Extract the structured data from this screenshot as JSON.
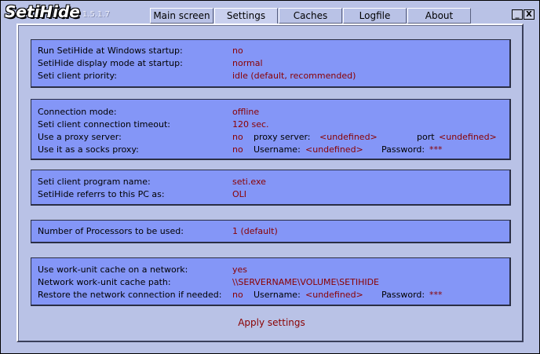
{
  "app": {
    "logo": "SetiHide",
    "version": "1.5.1.7"
  },
  "tabs": [
    "Main screen",
    "Settings",
    "Caches",
    "Logfile",
    "About"
  ],
  "window_buttons": {
    "minimize": "_",
    "close": "X"
  },
  "startup": {
    "run_at_startup_label": "Run SetiHide at Windows startup:",
    "run_at_startup_value": "no",
    "display_mode_label": "SetiHide display mode at startup:",
    "display_mode_value": "normal",
    "priority_label": "Seti client priority:",
    "priority_value": "idle (default, recommended)"
  },
  "connection": {
    "mode_label": "Connection mode:",
    "mode_value": "offline",
    "timeout_label": "Seti client connection timeout:",
    "timeout_value": "120 sec.",
    "proxy_label": "Use a proxy server:",
    "proxy_value": "no",
    "proxy_server_label": "proxy server:",
    "proxy_server_value": "<undefined>",
    "port_label": "port",
    "port_value": "<undefined>",
    "socks_label": "Use it as a socks proxy:",
    "socks_value": "no",
    "username_label": "Username:",
    "username_value": "<undefined>",
    "password_label": "Password:",
    "password_value": "***"
  },
  "program": {
    "name_label": "Seti client program name:",
    "name_value": "seti.exe",
    "pc_label": "SetiHide referrs to this PC as:",
    "pc_value": "OLI"
  },
  "processors": {
    "label": "Number of Processors to be used:",
    "value": "1 (default)"
  },
  "cache": {
    "use_label": "Use work-unit cache on a network:",
    "use_value": "yes",
    "path_label": "Network work-unit cache path:",
    "path_value": "\\\\SERVERNAME\\VOLUME\\SETIHIDE",
    "restore_label": "Restore the network connection if needed:",
    "restore_value": "no",
    "username_label": "Username:",
    "username_value": "<undefined>",
    "password_label": "Password:",
    "password_value": "***"
  },
  "apply_label": "Apply settings"
}
